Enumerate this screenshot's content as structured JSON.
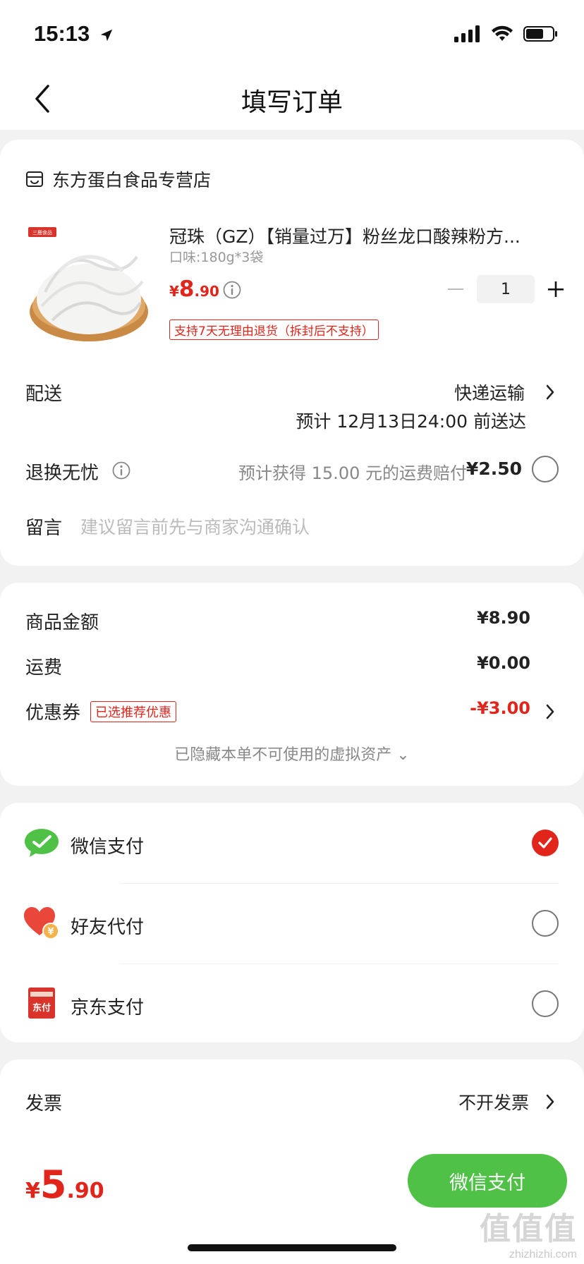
{
  "status_bar": {
    "time": "15:13"
  },
  "nav": {
    "title": "填写订单"
  },
  "store": {
    "name": "东方蛋白食品专营店"
  },
  "product": {
    "title": "冠珠（GZ）【销量过万】粉丝龙口酸辣粉方...",
    "spec": "口味:180g*3袋",
    "price_symbol": "¥",
    "price_int": "8",
    "price_dec": ".90",
    "quantity": "1",
    "return_badge": "支持7天无理由退货（拆封后不支持）",
    "image_tag": "三鹿食品"
  },
  "delivery": {
    "label": "配送",
    "method": "快递运输",
    "eta": "预计 12月13日24:00 前送达"
  },
  "return_worry": {
    "label": "退换无忧",
    "desc": "预计获得 15.00 元的运费赔付",
    "price": "¥2.50"
  },
  "message": {
    "label": "留言",
    "placeholder": "建议留言前先与商家沟通确认"
  },
  "summary": {
    "goods_label": "商品金额",
    "goods_value": "¥8.90",
    "shipping_label": "运费",
    "shipping_value": "¥0.00",
    "coupon_label": "优惠券",
    "coupon_badge": "已选推荐优惠",
    "coupon_value": "-¥3.00",
    "hidden_assets": "已隐藏本单不可使用的虚拟资产 ⌄"
  },
  "payment": {
    "methods": [
      {
        "label": "微信支付",
        "selected": true
      },
      {
        "label": "好友代付",
        "selected": false
      },
      {
        "label": "京东支付",
        "selected": false
      }
    ],
    "jd_icon_text": "东付"
  },
  "invoice": {
    "label": "发票",
    "value": "不开发票"
  },
  "bottom": {
    "total_symbol": "¥",
    "total_int": "5",
    "total_dec": ".90",
    "pay_button": "微信支付"
  },
  "watermark": {
    "logo": "值值值",
    "site": "zhizhizhi.com"
  },
  "colors": {
    "accent_red": "#e1251b",
    "wechat_green": "#4fc146"
  }
}
